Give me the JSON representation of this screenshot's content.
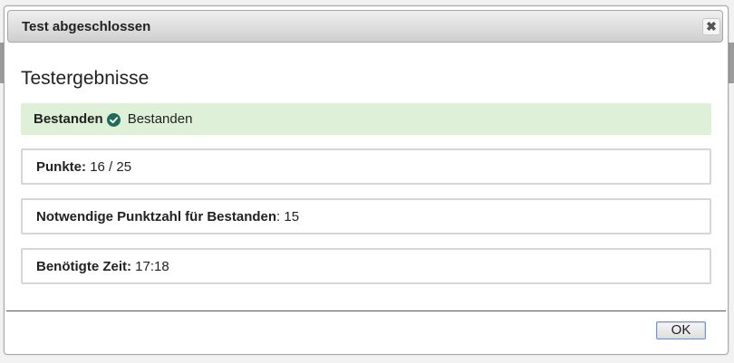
{
  "dialog": {
    "title": "Test abgeschlossen",
    "close_symbol": "✖",
    "close_icon": "close-icon"
  },
  "results": {
    "heading": "Testergebnisse",
    "status": {
      "label": "Bestanden",
      "icon": "check-circle-icon",
      "value": "Bestanden",
      "background": "#dff0d8",
      "icon_color": "#1f6b57"
    },
    "points": {
      "label": "Punkte:",
      "value": "16 / 25"
    },
    "required": {
      "label": "Notwendige Punktzahl für Bestanden",
      "separator": ": ",
      "value": "15"
    },
    "time": {
      "label": "Benötigte Zeit:",
      "value": "17:18"
    }
  },
  "footer": {
    "ok_label": "OK"
  }
}
